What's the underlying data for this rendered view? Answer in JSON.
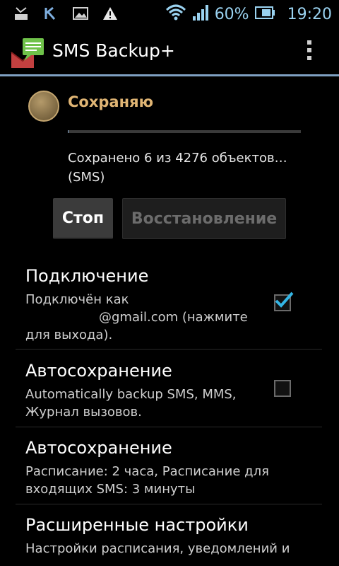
{
  "status_bar": {
    "battery": "60%",
    "time": "19:20",
    "left_icons": [
      "missed-call-icon",
      "vk-icon",
      "image-icon",
      "warning-icon"
    ],
    "right_icons": [
      "wifi-icon",
      "signal-icon",
      "battery-icon"
    ],
    "accent": "#9ad2f0"
  },
  "action_bar": {
    "title": "SMS Backup+",
    "menu_icon": "overflow-menu-icon",
    "accent": "#7fa0c2"
  },
  "status": {
    "title": "Сохраняю",
    "progress": 0.0014,
    "detail_line1": "Сохранено 6 из 4276 объектов…",
    "detail_line2": "(SMS)",
    "title_color": "#e0b574"
  },
  "buttons": {
    "stop": "Стоп",
    "restore": "Восстановление"
  },
  "preferences": [
    {
      "title": "Подключение",
      "summary_line1": "Подключён как",
      "summary_line2": "@gmail.com (нажмите",
      "summary_line3": "для выхода).",
      "checked": true
    },
    {
      "title": "Автосохранение",
      "summary_line1": "Automatically backup SMS, MMS,",
      "summary_line2": "Журнал вызовов.",
      "checked": false
    },
    {
      "title": "Автосохранение",
      "summary_line1": "Расписание: 2 часа, Расписание для",
      "summary_line2": "входящих SMS: 3 минуты"
    },
    {
      "title": "Расширенные настройки",
      "summary_line1": "Настройки расписания, уведомлений и"
    }
  ]
}
